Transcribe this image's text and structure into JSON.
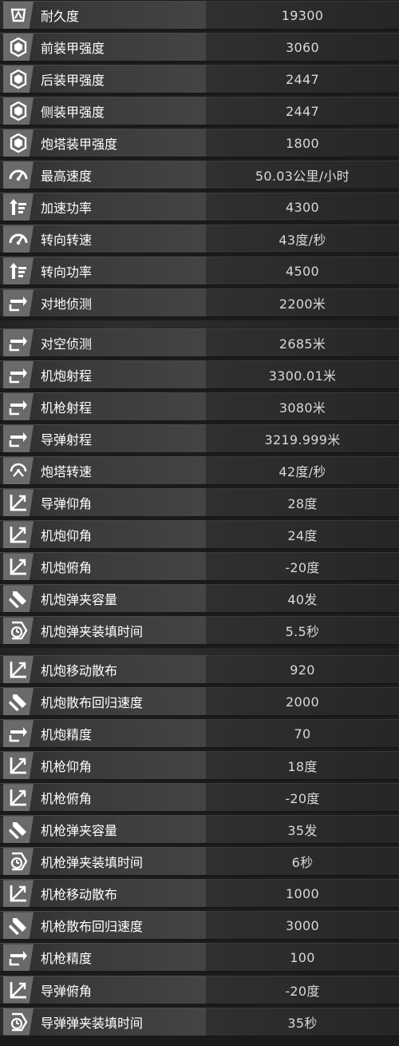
{
  "stats": [
    {
      "label": "耐久度",
      "value": "19300",
      "icon": "armor-durability-icon"
    },
    {
      "label": "前装甲强度",
      "value": "3060",
      "icon": "armor-plate-icon"
    },
    {
      "label": "后装甲强度",
      "value": "2447",
      "icon": "armor-plate-icon"
    },
    {
      "label": "侧装甲强度",
      "value": "2447",
      "icon": "armor-plate-icon"
    },
    {
      "label": "炮塔装甲强度",
      "value": "1800",
      "icon": "armor-plate-icon"
    },
    {
      "label": "最高速度",
      "value": "50.03公里/小时",
      "icon": "speedometer-icon"
    },
    {
      "label": "加速功率",
      "value": "4300",
      "icon": "power-arrow-icon"
    },
    {
      "label": "转向转速",
      "value": "43度/秒",
      "icon": "speedometer-icon"
    },
    {
      "label": "转向功率",
      "value": "4500",
      "icon": "power-arrow-icon"
    },
    {
      "label": "对地侦测",
      "value": "2200米",
      "icon": "range-arrows-icon"
    },
    {
      "label": "对空侦测",
      "value": "2685米",
      "icon": "range-arrows-icon"
    },
    {
      "label": "机炮射程",
      "value": "3300.01米",
      "icon": "range-arrows-icon"
    },
    {
      "label": "机枪射程",
      "value": "3080米",
      "icon": "range-arrows-icon"
    },
    {
      "label": "导弹射程",
      "value": "3219.999米",
      "icon": "range-arrows-icon"
    },
    {
      "label": "炮塔转速",
      "value": "42度/秒",
      "icon": "turret-rotation-icon"
    },
    {
      "label": "导弹仰角",
      "value": "28度",
      "icon": "angle-icon"
    },
    {
      "label": "机炮仰角",
      "value": "24度",
      "icon": "angle-icon"
    },
    {
      "label": "机炮俯角",
      "value": "-20度",
      "icon": "angle-icon"
    },
    {
      "label": "机炮弹夹容量",
      "value": "40发",
      "icon": "ammo-icon"
    },
    {
      "label": "机炮弹夹装填时间",
      "value": "5.5秒",
      "icon": "reload-timer-icon"
    },
    {
      "label": "机炮移动散布",
      "value": "920",
      "icon": "angle-icon"
    },
    {
      "label": "机炮散布回归速度",
      "value": "2000",
      "icon": "ammo-icon"
    },
    {
      "label": "机炮精度",
      "value": "70",
      "icon": "range-arrows-icon"
    },
    {
      "label": "机枪仰角",
      "value": "18度",
      "icon": "angle-icon"
    },
    {
      "label": "机枪俯角",
      "value": "-20度",
      "icon": "angle-icon"
    },
    {
      "label": "机枪弹夹容量",
      "value": "35发",
      "icon": "ammo-icon"
    },
    {
      "label": "机枪弹夹装填时间",
      "value": "6秒",
      "icon": "reload-timer-icon"
    },
    {
      "label": "机枪移动散布",
      "value": "1000",
      "icon": "angle-icon"
    },
    {
      "label": "机枪散布回归速度",
      "value": "3000",
      "icon": "ammo-icon"
    },
    {
      "label": "机枪精度",
      "value": "100",
      "icon": "range-arrows-icon"
    },
    {
      "label": "导弹俯角",
      "value": "-20度",
      "icon": "angle-icon"
    },
    {
      "label": "导弹弹夹装填时间",
      "value": "35秒",
      "icon": "reload-timer-icon"
    }
  ]
}
